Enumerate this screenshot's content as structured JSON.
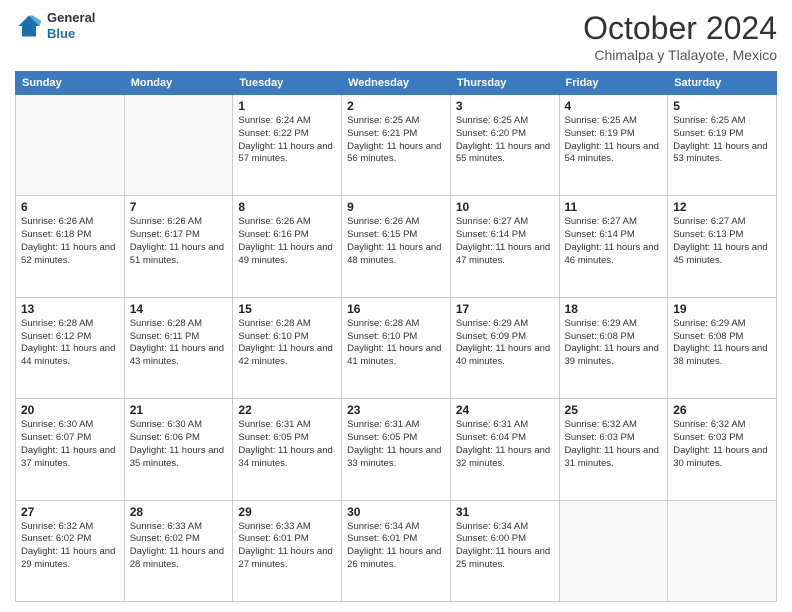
{
  "header": {
    "logo_general": "General",
    "logo_blue": "Blue",
    "month": "October 2024",
    "location": "Chimalpa y Tlalayote, Mexico"
  },
  "weekdays": [
    "Sunday",
    "Monday",
    "Tuesday",
    "Wednesday",
    "Thursday",
    "Friday",
    "Saturday"
  ],
  "weeks": [
    [
      {
        "day": "",
        "info": ""
      },
      {
        "day": "",
        "info": ""
      },
      {
        "day": "1",
        "info": "Sunrise: 6:24 AM\nSunset: 6:22 PM\nDaylight: 11 hours and 57 minutes."
      },
      {
        "day": "2",
        "info": "Sunrise: 6:25 AM\nSunset: 6:21 PM\nDaylight: 11 hours and 56 minutes."
      },
      {
        "day": "3",
        "info": "Sunrise: 6:25 AM\nSunset: 6:20 PM\nDaylight: 11 hours and 55 minutes."
      },
      {
        "day": "4",
        "info": "Sunrise: 6:25 AM\nSunset: 6:19 PM\nDaylight: 11 hours and 54 minutes."
      },
      {
        "day": "5",
        "info": "Sunrise: 6:25 AM\nSunset: 6:19 PM\nDaylight: 11 hours and 53 minutes."
      }
    ],
    [
      {
        "day": "6",
        "info": "Sunrise: 6:26 AM\nSunset: 6:18 PM\nDaylight: 11 hours and 52 minutes."
      },
      {
        "day": "7",
        "info": "Sunrise: 6:26 AM\nSunset: 6:17 PM\nDaylight: 11 hours and 51 minutes."
      },
      {
        "day": "8",
        "info": "Sunrise: 6:26 AM\nSunset: 6:16 PM\nDaylight: 11 hours and 49 minutes."
      },
      {
        "day": "9",
        "info": "Sunrise: 6:26 AM\nSunset: 6:15 PM\nDaylight: 11 hours and 48 minutes."
      },
      {
        "day": "10",
        "info": "Sunrise: 6:27 AM\nSunset: 6:14 PM\nDaylight: 11 hours and 47 minutes."
      },
      {
        "day": "11",
        "info": "Sunrise: 6:27 AM\nSunset: 6:14 PM\nDaylight: 11 hours and 46 minutes."
      },
      {
        "day": "12",
        "info": "Sunrise: 6:27 AM\nSunset: 6:13 PM\nDaylight: 11 hours and 45 minutes."
      }
    ],
    [
      {
        "day": "13",
        "info": "Sunrise: 6:28 AM\nSunset: 6:12 PM\nDaylight: 11 hours and 44 minutes."
      },
      {
        "day": "14",
        "info": "Sunrise: 6:28 AM\nSunset: 6:11 PM\nDaylight: 11 hours and 43 minutes."
      },
      {
        "day": "15",
        "info": "Sunrise: 6:28 AM\nSunset: 6:10 PM\nDaylight: 11 hours and 42 minutes."
      },
      {
        "day": "16",
        "info": "Sunrise: 6:28 AM\nSunset: 6:10 PM\nDaylight: 11 hours and 41 minutes."
      },
      {
        "day": "17",
        "info": "Sunrise: 6:29 AM\nSunset: 6:09 PM\nDaylight: 11 hours and 40 minutes."
      },
      {
        "day": "18",
        "info": "Sunrise: 6:29 AM\nSunset: 6:08 PM\nDaylight: 11 hours and 39 minutes."
      },
      {
        "day": "19",
        "info": "Sunrise: 6:29 AM\nSunset: 6:08 PM\nDaylight: 11 hours and 38 minutes."
      }
    ],
    [
      {
        "day": "20",
        "info": "Sunrise: 6:30 AM\nSunset: 6:07 PM\nDaylight: 11 hours and 37 minutes."
      },
      {
        "day": "21",
        "info": "Sunrise: 6:30 AM\nSunset: 6:06 PM\nDaylight: 11 hours and 35 minutes."
      },
      {
        "day": "22",
        "info": "Sunrise: 6:31 AM\nSunset: 6:05 PM\nDaylight: 11 hours and 34 minutes."
      },
      {
        "day": "23",
        "info": "Sunrise: 6:31 AM\nSunset: 6:05 PM\nDaylight: 11 hours and 33 minutes."
      },
      {
        "day": "24",
        "info": "Sunrise: 6:31 AM\nSunset: 6:04 PM\nDaylight: 11 hours and 32 minutes."
      },
      {
        "day": "25",
        "info": "Sunrise: 6:32 AM\nSunset: 6:03 PM\nDaylight: 11 hours and 31 minutes."
      },
      {
        "day": "26",
        "info": "Sunrise: 6:32 AM\nSunset: 6:03 PM\nDaylight: 11 hours and 30 minutes."
      }
    ],
    [
      {
        "day": "27",
        "info": "Sunrise: 6:32 AM\nSunset: 6:02 PM\nDaylight: 11 hours and 29 minutes."
      },
      {
        "day": "28",
        "info": "Sunrise: 6:33 AM\nSunset: 6:02 PM\nDaylight: 11 hours and 28 minutes."
      },
      {
        "day": "29",
        "info": "Sunrise: 6:33 AM\nSunset: 6:01 PM\nDaylight: 11 hours and 27 minutes."
      },
      {
        "day": "30",
        "info": "Sunrise: 6:34 AM\nSunset: 6:01 PM\nDaylight: 11 hours and 26 minutes."
      },
      {
        "day": "31",
        "info": "Sunrise: 6:34 AM\nSunset: 6:00 PM\nDaylight: 11 hours and 25 minutes."
      },
      {
        "day": "",
        "info": ""
      },
      {
        "day": "",
        "info": ""
      }
    ]
  ]
}
